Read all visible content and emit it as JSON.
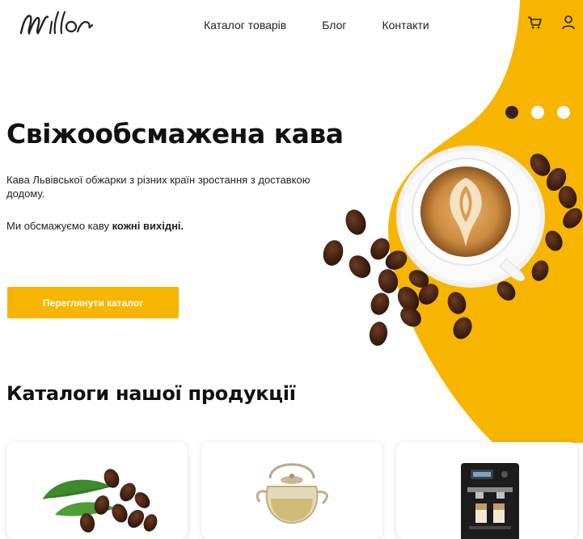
{
  "header": {
    "logo_text": "Millor",
    "nav": [
      {
        "label": "Каталог товарів"
      },
      {
        "label": "Блог"
      },
      {
        "label": "Контакти"
      }
    ],
    "icons": [
      "cart-icon",
      "user-icon"
    ]
  },
  "hero": {
    "title": "Свіжообсмажена кава",
    "description": "Кава Львівської обжарки з різних країн зростання з доставкою додому.",
    "note_prefix": "Ми обсмажуємо каву ",
    "note_bold": "кожні вихідні.",
    "cta_label": "Переглянути каталог",
    "slides_total": 3,
    "active_slide": 1
  },
  "catalog": {
    "title": "Каталоги нашої продукції",
    "cards": [
      {
        "image": "coffee-beans-image"
      },
      {
        "image": "teapot-image"
      },
      {
        "image": "coffee-machine-image"
      }
    ]
  },
  "colors": {
    "accent": "#f7b500",
    "dark_dot": "#3a1f14"
  }
}
